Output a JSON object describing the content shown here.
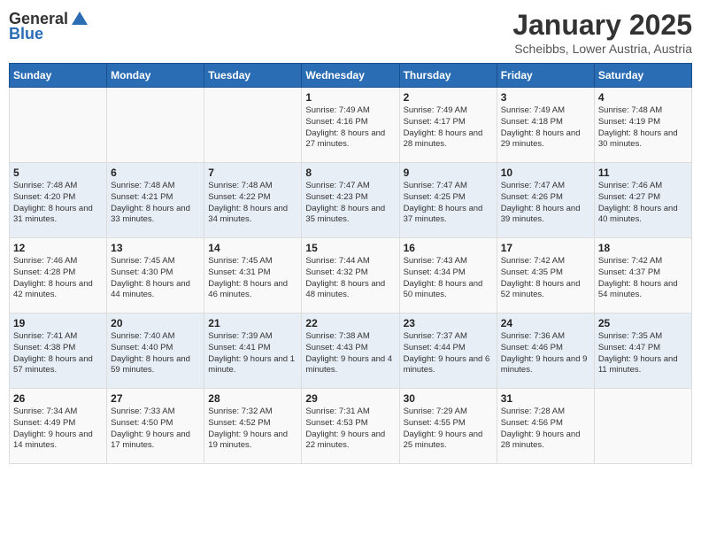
{
  "header": {
    "logo_general": "General",
    "logo_blue": "Blue",
    "title": "January 2025",
    "subtitle": "Scheibbs, Lower Austria, Austria"
  },
  "calendar": {
    "days_of_week": [
      "Sunday",
      "Monday",
      "Tuesday",
      "Wednesday",
      "Thursday",
      "Friday",
      "Saturday"
    ],
    "weeks": [
      {
        "cells": [
          {
            "day": "",
            "content": ""
          },
          {
            "day": "",
            "content": ""
          },
          {
            "day": "",
            "content": ""
          },
          {
            "day": "1",
            "content": "Sunrise: 7:49 AM\nSunset: 4:16 PM\nDaylight: 8 hours and 27 minutes."
          },
          {
            "day": "2",
            "content": "Sunrise: 7:49 AM\nSunset: 4:17 PM\nDaylight: 8 hours and 28 minutes."
          },
          {
            "day": "3",
            "content": "Sunrise: 7:49 AM\nSunset: 4:18 PM\nDaylight: 8 hours and 29 minutes."
          },
          {
            "day": "4",
            "content": "Sunrise: 7:48 AM\nSunset: 4:19 PM\nDaylight: 8 hours and 30 minutes."
          }
        ]
      },
      {
        "cells": [
          {
            "day": "5",
            "content": "Sunrise: 7:48 AM\nSunset: 4:20 PM\nDaylight: 8 hours and 31 minutes."
          },
          {
            "day": "6",
            "content": "Sunrise: 7:48 AM\nSunset: 4:21 PM\nDaylight: 8 hours and 33 minutes."
          },
          {
            "day": "7",
            "content": "Sunrise: 7:48 AM\nSunset: 4:22 PM\nDaylight: 8 hours and 34 minutes."
          },
          {
            "day": "8",
            "content": "Sunrise: 7:47 AM\nSunset: 4:23 PM\nDaylight: 8 hours and 35 minutes."
          },
          {
            "day": "9",
            "content": "Sunrise: 7:47 AM\nSunset: 4:25 PM\nDaylight: 8 hours and 37 minutes."
          },
          {
            "day": "10",
            "content": "Sunrise: 7:47 AM\nSunset: 4:26 PM\nDaylight: 8 hours and 39 minutes."
          },
          {
            "day": "11",
            "content": "Sunrise: 7:46 AM\nSunset: 4:27 PM\nDaylight: 8 hours and 40 minutes."
          }
        ]
      },
      {
        "cells": [
          {
            "day": "12",
            "content": "Sunrise: 7:46 AM\nSunset: 4:28 PM\nDaylight: 8 hours and 42 minutes."
          },
          {
            "day": "13",
            "content": "Sunrise: 7:45 AM\nSunset: 4:30 PM\nDaylight: 8 hours and 44 minutes."
          },
          {
            "day": "14",
            "content": "Sunrise: 7:45 AM\nSunset: 4:31 PM\nDaylight: 8 hours and 46 minutes."
          },
          {
            "day": "15",
            "content": "Sunrise: 7:44 AM\nSunset: 4:32 PM\nDaylight: 8 hours and 48 minutes."
          },
          {
            "day": "16",
            "content": "Sunrise: 7:43 AM\nSunset: 4:34 PM\nDaylight: 8 hours and 50 minutes."
          },
          {
            "day": "17",
            "content": "Sunrise: 7:42 AM\nSunset: 4:35 PM\nDaylight: 8 hours and 52 minutes."
          },
          {
            "day": "18",
            "content": "Sunrise: 7:42 AM\nSunset: 4:37 PM\nDaylight: 8 hours and 54 minutes."
          }
        ]
      },
      {
        "cells": [
          {
            "day": "19",
            "content": "Sunrise: 7:41 AM\nSunset: 4:38 PM\nDaylight: 8 hours and 57 minutes."
          },
          {
            "day": "20",
            "content": "Sunrise: 7:40 AM\nSunset: 4:40 PM\nDaylight: 8 hours and 59 minutes."
          },
          {
            "day": "21",
            "content": "Sunrise: 7:39 AM\nSunset: 4:41 PM\nDaylight: 9 hours and 1 minute."
          },
          {
            "day": "22",
            "content": "Sunrise: 7:38 AM\nSunset: 4:43 PM\nDaylight: 9 hours and 4 minutes."
          },
          {
            "day": "23",
            "content": "Sunrise: 7:37 AM\nSunset: 4:44 PM\nDaylight: 9 hours and 6 minutes."
          },
          {
            "day": "24",
            "content": "Sunrise: 7:36 AM\nSunset: 4:46 PM\nDaylight: 9 hours and 9 minutes."
          },
          {
            "day": "25",
            "content": "Sunrise: 7:35 AM\nSunset: 4:47 PM\nDaylight: 9 hours and 11 minutes."
          }
        ]
      },
      {
        "cells": [
          {
            "day": "26",
            "content": "Sunrise: 7:34 AM\nSunset: 4:49 PM\nDaylight: 9 hours and 14 minutes."
          },
          {
            "day": "27",
            "content": "Sunrise: 7:33 AM\nSunset: 4:50 PM\nDaylight: 9 hours and 17 minutes."
          },
          {
            "day": "28",
            "content": "Sunrise: 7:32 AM\nSunset: 4:52 PM\nDaylight: 9 hours and 19 minutes."
          },
          {
            "day": "29",
            "content": "Sunrise: 7:31 AM\nSunset: 4:53 PM\nDaylight: 9 hours and 22 minutes."
          },
          {
            "day": "30",
            "content": "Sunrise: 7:29 AM\nSunset: 4:55 PM\nDaylight: 9 hours and 25 minutes."
          },
          {
            "day": "31",
            "content": "Sunrise: 7:28 AM\nSunset: 4:56 PM\nDaylight: 9 hours and 28 minutes."
          },
          {
            "day": "",
            "content": ""
          }
        ]
      }
    ]
  }
}
